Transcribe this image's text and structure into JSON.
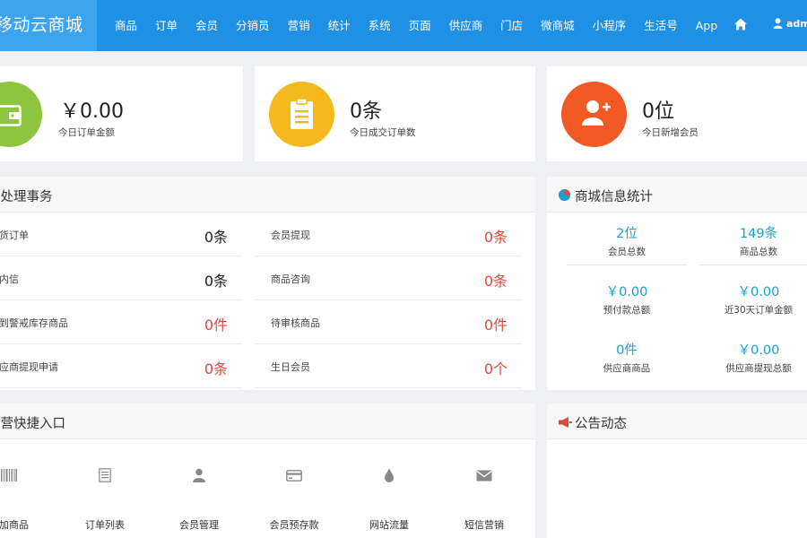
{
  "brand": "移动云商城",
  "nav": [
    "商品",
    "订单",
    "会员",
    "分销员",
    "营销",
    "统计",
    "系统",
    "页面",
    "供应商",
    "门店",
    "微商城",
    "小程序",
    "生活号",
    "App"
  ],
  "user": "adm",
  "icons": {
    "home": "home-icon",
    "user": "user-icon"
  },
  "stats": [
    {
      "value": "￥0.00",
      "label": "今日订单金额",
      "color": "#8cc63f",
      "icon": "wallet-icon"
    },
    {
      "value": "0条",
      "label": "今日成交订单数",
      "color": "#f5b81f",
      "icon": "clipboard-icon"
    },
    {
      "value": "0位",
      "label": "今日新增会员",
      "color": "#f25a25",
      "icon": "add-user-icon"
    }
  ],
  "todo": {
    "title": "待处理事务",
    "left": [
      {
        "label": "发货订单",
        "value": "0条",
        "color": "#222"
      },
      {
        "label": "站内信",
        "value": "0条",
        "color": "#222"
      },
      {
        "label": "达到警戒库存商品",
        "value": "0件",
        "color": "#e0483e"
      },
      {
        "label": "供应商提现申请",
        "value": "0条",
        "color": "#e0483e"
      }
    ],
    "right": [
      {
        "label": "会员提现",
        "value": "0条",
        "color": "#e0483e"
      },
      {
        "label": "商品咨询",
        "value": "0条",
        "color": "#e0483e"
      },
      {
        "label": "待审核商品",
        "value": "0件",
        "color": "#e0483e"
      },
      {
        "label": "生日会员",
        "value": "0个",
        "color": "#e0483e"
      }
    ]
  },
  "info": {
    "title": "商城信息统计",
    "items": [
      {
        "value": "2位",
        "label": "会员总数"
      },
      {
        "value": "149条",
        "label": "商品总数"
      },
      {
        "value": "￥0.00",
        "label": "预付款总额"
      },
      {
        "value": "￥0.00",
        "label": "近30天订单金额"
      },
      {
        "value": "0件",
        "label": "供应商商品"
      },
      {
        "value": "￥0.00",
        "label": "供应商提现总额"
      }
    ]
  },
  "quick": {
    "title": "运营快捷入口",
    "items": [
      {
        "label": "添加商品",
        "icon": "barcode-icon"
      },
      {
        "label": "订单列表",
        "icon": "list-icon"
      },
      {
        "label": "会员管理",
        "icon": "person-icon"
      },
      {
        "label": "会员预存款",
        "icon": "card-icon"
      },
      {
        "label": "网站流量",
        "icon": "drop-icon"
      },
      {
        "label": "短信营销",
        "icon": "mail-icon"
      }
    ]
  },
  "notice": {
    "title": "公告动态"
  }
}
